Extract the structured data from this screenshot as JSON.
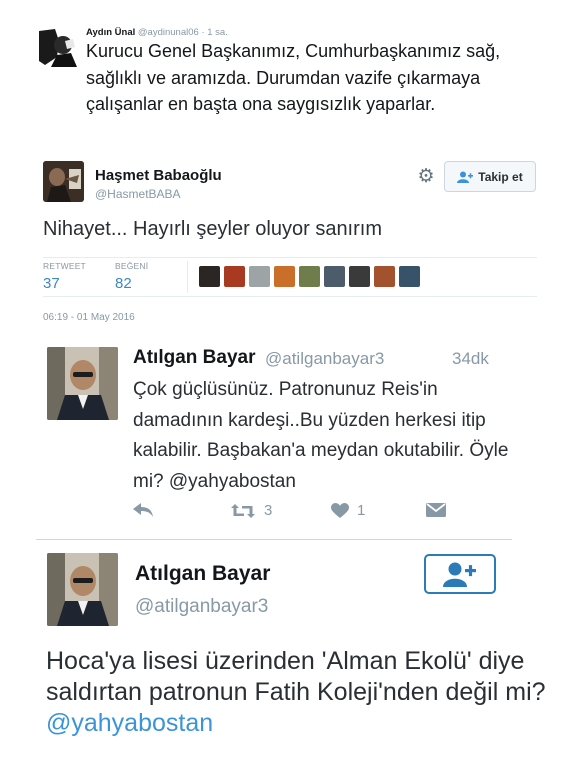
{
  "tweet1": {
    "name": "Aydın Ünal",
    "handle": "@aydinunal06",
    "time": "· 1 sa.",
    "text": "Kurucu Genel Başkanımız, Cumhurbaşkanımız sağ, sağlıklı ve aramızda. Durumdan vazife çıkarmaya çalışanlar en başta ona saygısızlık yaparlar."
  },
  "tweet2": {
    "name": "Haşmet Babaoğlu",
    "handle": "@HasmetBABA",
    "follow_label": "Takip et",
    "text": "Nihayet... Hayırlı şeyler oluyor sanırım",
    "retweet_label": "RETWEET",
    "retweet_count": "37",
    "likes_label": "BEĞENİ",
    "likes_count": "82",
    "liker_avatars": [
      "#2b2623",
      "#a83a22",
      "#9da4a6",
      "#c96f2a",
      "#6f7d4c",
      "#4d5c6a",
      "#3a3a3a",
      "#a2522c",
      "#38526a"
    ],
    "timestamp": "06:19 - 01 May 2016"
  },
  "tweet3": {
    "name": "Atılgan Bayar",
    "handle": "@atilganbayar3",
    "age": "34dk",
    "text": "Çok güçlüsünüz. Patronunuz Reis'in damadının kardeşi..Bu yüzden herkesi itip kalabilir. Başbakan'a meydan okutabilir. Öyle mi? @yahyabostan",
    "retweet_count": "3",
    "like_count": "1"
  },
  "tweet4": {
    "name": "Atılgan Bayar",
    "handle": "@atilganbayar3",
    "text_main": "Hoca'ya lisesi üzerinden 'Alman Ekolü' diye saldırtan patronun Fatih Koleji'nden değil mi?",
    "mention": "@yahyabostan"
  },
  "colors": {
    "link": "#3b94d9",
    "stat_value": "#3b88c3",
    "muted": "#8899a6",
    "follow_border": "#2b7bb9"
  }
}
